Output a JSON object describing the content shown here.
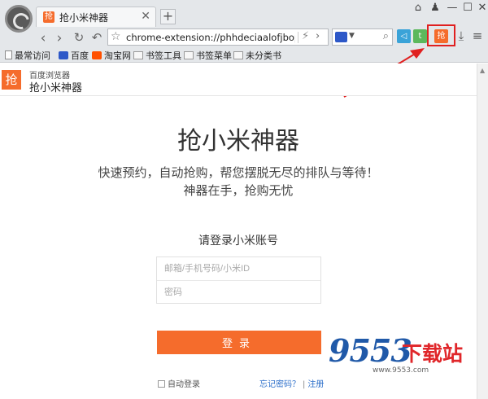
{
  "browser": {
    "tab_title": "抢小米神器",
    "tab_icon": "抢",
    "tab_close": "✕",
    "new_tab": "+",
    "address_url": "chrome-extension://phhdeciaalofjbopjhfl",
    "ext_icon_label": "抢",
    "bookmarks": [
      {
        "label": "最常访问"
      },
      {
        "label": "百度"
      },
      {
        "label": "淘宝网"
      },
      {
        "label": "书签工具"
      },
      {
        "label": "书签菜单"
      },
      {
        "label": "未分类书"
      }
    ]
  },
  "page": {
    "brand_logo": "抢",
    "brand_sub": "百度浏览器",
    "brand_name": "抢小米神器",
    "hero_title": "抢小米神器",
    "hero_line1": "快速预约，自动抢购，帮您摆脱无尽的排队与等待！",
    "hero_line2": "神器在手，抢购无忧",
    "login_title": "请登录小米账号",
    "account_placeholder": "邮箱/手机号码/小米ID",
    "password_placeholder": "密码",
    "login_button": "登录",
    "auto_login": "自动登录",
    "forgot_password": "忘记密码？",
    "register": "注册",
    "links_separator": "|"
  },
  "watermark": {
    "number": "9553",
    "chinese": "下载站",
    "url": "www.9553.com"
  },
  "colors": {
    "accent": "#f56c2c",
    "highlight": "#e02020",
    "link": "#2a6dc9"
  }
}
